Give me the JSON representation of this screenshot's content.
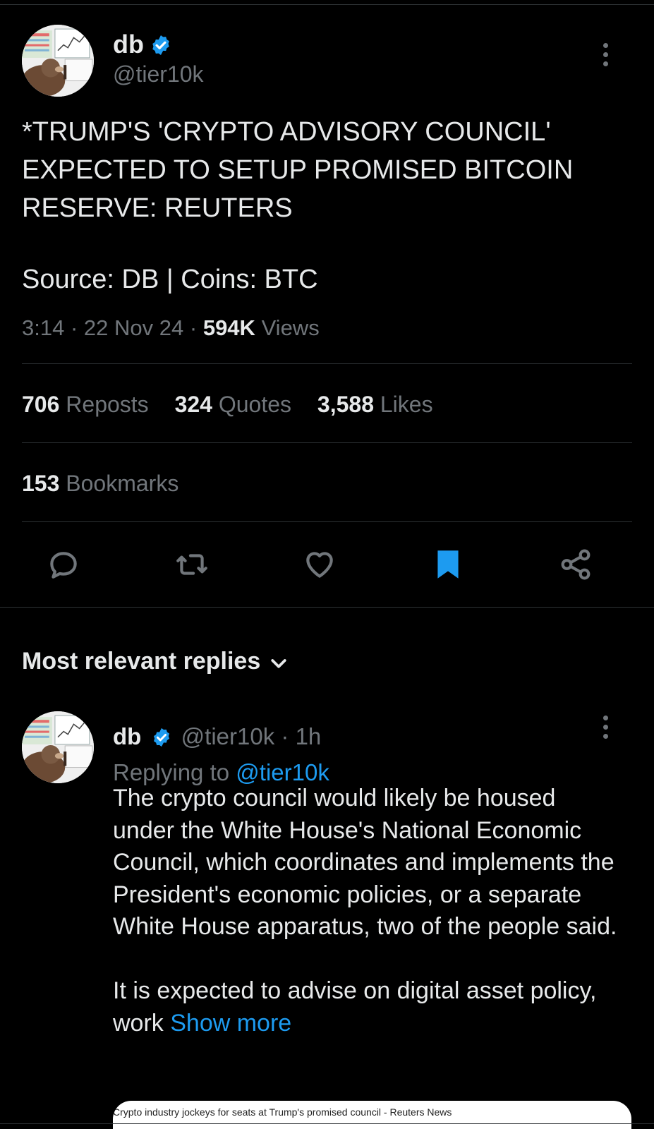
{
  "tweet": {
    "author_name": "db",
    "handle": "@tier10k",
    "verified_icon": "verified-badge-icon",
    "body": "*TRUMP'S 'CRYPTO ADVISORY COUNCIL' EXPECTED TO SETUP PROMISED BITCOIN RESERVE: REUTERS",
    "source_line": "Source: DB | Coins: BTC",
    "time": "3:14",
    "date": "22 Nov 24",
    "views_count": "594K",
    "views_label": "Views",
    "sep": "·"
  },
  "stats": {
    "reposts_count": "706",
    "reposts_label": "Reposts",
    "quotes_count": "324",
    "quotes_label": "Quotes",
    "likes_count": "3,588",
    "likes_label": "Likes",
    "bookmarks_count": "153",
    "bookmarks_label": "Bookmarks"
  },
  "actions": {
    "reply_icon": "reply-icon",
    "repost_icon": "repost-icon",
    "like_icon": "heart-icon",
    "bookmark_icon": "bookmark-icon",
    "share_icon": "share-icon",
    "bookmark_active_color": "#1d9bf0"
  },
  "replies": {
    "header": "Most relevant replies",
    "reply": {
      "author_name": "db",
      "handle": "@tier10k",
      "age": "1h",
      "replying_prefix": "Replying to",
      "replying_handle": "@tier10k",
      "text": "The crypto council would likely be housed under the White House's National Economic Council, which coordinates and implements the President's economic policies, or a separate White House apparatus, two of the people said.\n\nIt is expected to advise on digital asset policy, work ",
      "show_more": "Show more",
      "card_title": "Crypto industry jockeys for seats at Trump's promised council - Reuters News"
    }
  },
  "colors": {
    "background": "#000000",
    "text": "#e7e9ea",
    "muted": "#71767b",
    "accent": "#1d9bf0",
    "divider": "#2f3336"
  }
}
